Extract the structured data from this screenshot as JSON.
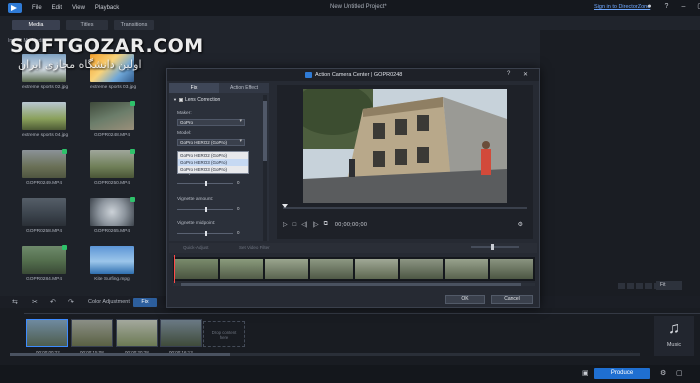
{
  "window": {
    "menu": [
      "File",
      "Edit",
      "View",
      "Playback"
    ],
    "title": "New Untitled Project*",
    "signin": "Sign in to DirectorZone",
    "icons": [
      "user-icon",
      "help-icon",
      "minimize-icon",
      "maximize-icon",
      "close-icon"
    ]
  },
  "library": {
    "tabs": [
      "Media",
      "Titles",
      "Transitions"
    ],
    "toolbar_label": "Import My Media",
    "items": [
      {
        "label": "extreme sports 02.jpg",
        "checked": false
      },
      {
        "label": "extreme sports 03.jpg",
        "checked": false
      },
      {
        "label": "extreme sports 04.jpg",
        "checked": false
      },
      {
        "label": "GOPR0248.MP4",
        "checked": true
      },
      {
        "label": "GOPR0249.MP4",
        "checked": true
      },
      {
        "label": "GOPR0250.MP4",
        "checked": true
      },
      {
        "label": "GOPR0258.MP4",
        "checked": false
      },
      {
        "label": "GOPR0265.MP4",
        "checked": true
      },
      {
        "label": "GOPR0284.MP4",
        "checked": true
      },
      {
        "label": "Kite Surfing.mpg",
        "checked": false
      }
    ]
  },
  "dialog": {
    "title": "Action Camera Center | GOPR0248",
    "tabs": [
      "Fix",
      "Action Effect"
    ],
    "section": "Lens Correction",
    "maker_label": "Maker:",
    "maker_value": "GoPro",
    "model_label": "Model:",
    "model_value": "GoPro HERO2 (GoPro)",
    "model_options": [
      "GoPro HERO2 (GoPro)",
      "GoPro HERO3 (GoPro)",
      "GoPro HERO3 (GoPro)"
    ],
    "fisheye_label": "Fisheye distortion:",
    "fisheye_value": "0",
    "vignette_amount_label": "Vignette amount:",
    "vignette_amount_value": "0",
    "vignette_midpoint_label": "Vignette midpoint:",
    "vignette_midpoint_value": "0",
    "timecode": "00;00;00;00",
    "toolbar": [
      "Quick-Adjust",
      "Set Video Filter"
    ],
    "ok": "OK",
    "cancel": "Cancel"
  },
  "toolbar": {
    "color_adjustment": "Color Adjustment",
    "fix": "Fix"
  },
  "timeline": {
    "clips": [
      {
        "time": "00;00;00;22"
      },
      {
        "time": "00;00;15;08"
      },
      {
        "time": "00;00;20;28"
      },
      {
        "time": "00;00;16;13"
      }
    ],
    "drop_hint": "Drop content here",
    "music_label": "Music",
    "fit": "Fit"
  },
  "bottom": {
    "produce": "Produce"
  },
  "watermark": {
    "line1": "SOFTGOZAR.COM",
    "line2": "اولین دانشگاه مجازی ایران"
  },
  "colors": {
    "accent": "#1f6fd1",
    "selection": "#3d8bff",
    "check": "#2ec26a",
    "background": "#20242c"
  }
}
